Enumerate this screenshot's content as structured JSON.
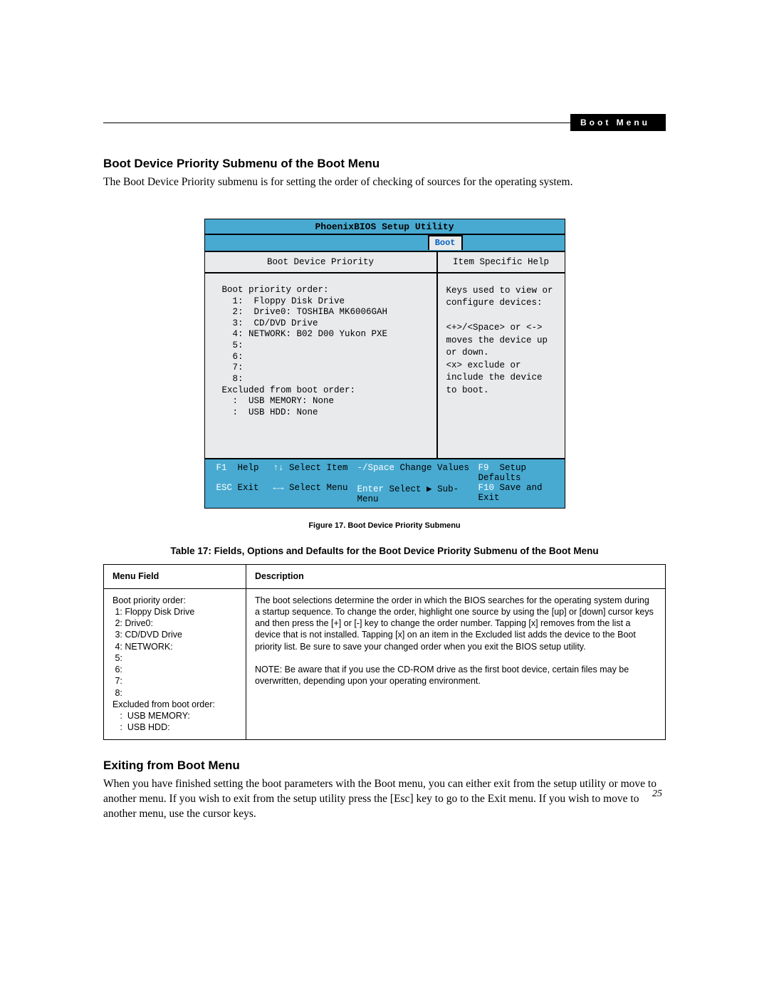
{
  "header": {
    "tag": "Boot Menu"
  },
  "section1": {
    "title": "Boot Device Priority Submenu of the Boot Menu",
    "intro": "The Boot Device Priority submenu is for setting the order of checking of sources for the operating system."
  },
  "bios": {
    "title": "PhoenixBIOS Setup Utility",
    "active_tab": "Boot",
    "left_head": "Boot Device Priority",
    "right_head": "Item Specific Help",
    "boot_order": {
      "label": "Boot priority order:",
      "items": [
        "1:  Floppy Disk Drive",
        "2:  Drive0: TOSHIBA MK6006GAH",
        "3:  CD/DVD Drive",
        "4: NETWORK: B02 D00 Yukon PXE",
        "5:",
        "6:",
        "7:",
        "8:"
      ],
      "excluded_label": "Excluded from boot order:",
      "excluded": [
        ":  USB MEMORY: None",
        ":  USB HDD: None"
      ]
    },
    "help_lines": [
      "Keys used to view or configure devices:",
      "",
      "<+>/<Space> or <-> moves the device up or down.",
      "<x> exclude or include the device to boot."
    ],
    "footer": {
      "row1": {
        "k1": "F1",
        "l1": "Help",
        "k2": "↑↓",
        "l2": "Select Item",
        "k3": "-/Space",
        "l3": "Change Values",
        "k4": "F9",
        "l4": "Setup Defaults"
      },
      "row2": {
        "k1": "ESC",
        "l1": "Exit",
        "k2": "←→",
        "l2": "Select Menu",
        "k3": "Enter",
        "l3": "Select ▶ Sub-Menu",
        "k4": "F10",
        "l4": "Save and Exit"
      }
    }
  },
  "figure_caption": "Figure 17.  Boot Device Priority Submenu",
  "table_caption": "Table 17: Fields, Options and Defaults for the Boot Device Priority Submenu of the Boot Menu",
  "table": {
    "headers": {
      "col1": "Menu Field",
      "col2": "Description"
    },
    "row": {
      "menu_field": "Boot priority order:\n 1: Floppy Disk Drive\n 2: Drive0:\n 3: CD/DVD Drive\n 4: NETWORK:\n 5:\n 6:\n 7:\n 8:\nExcluded from boot order:\n   :  USB MEMORY:\n   :  USB HDD:",
      "description_p1": "The boot selections determine the order in which the BIOS searches for the operating system during a startup sequence. To change the order, highlight one source by using the [up] or [down] cursor keys and then press the [+] or [-] key to change the order number. Tapping [x] removes from the list a device that is not installed. Tapping [x] on an item in the Excluded list adds the device to the Boot priority list. Be sure to save your changed order when you exit the BIOS setup utility.",
      "description_p2": "NOTE: Be aware that if you use the CD-ROM drive as the first boot device, certain files may be overwritten, depending upon your operating environment."
    }
  },
  "section2": {
    "title": "Exiting from Boot Menu",
    "body": "When you have finished setting the boot parameters with the Boot menu, you can either exit from the setup utility or move to another menu. If you wish to exit from the setup utility press the [Esc] key to go to the Exit menu. If you wish to move to another menu, use the cursor keys."
  },
  "page_number": "25"
}
